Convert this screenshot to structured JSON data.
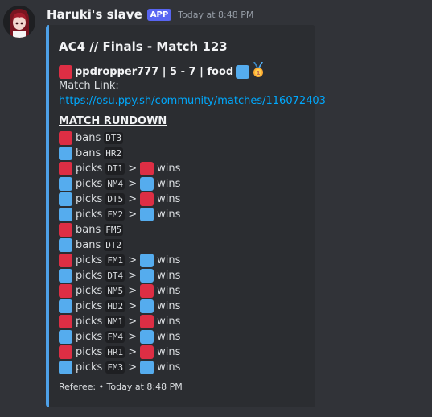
{
  "message": {
    "username": "Haruki's slave",
    "badge": "APP",
    "timestamp": "Today at 8:48 PM"
  },
  "embed": {
    "accent_color": "#4ea1e8",
    "title": "AC4 // Finals - Match 123",
    "score_line": "ppdropper777 | 5 - 7 | food",
    "left_team_color": "red",
    "right_team_color": "blue",
    "winner_icon": "1st-place-medal-icon",
    "match_link_label": "Match Link:",
    "match_link_url": "https://osu.ppy.sh/community/matches/116072403",
    "rundown_title": "MATCH RUNDOWN",
    "rows": [
      {
        "team": "red",
        "action": "bans",
        "map": "DT3"
      },
      {
        "team": "blue",
        "action": "bans",
        "map": "HR2"
      },
      {
        "team": "red",
        "action": "picks",
        "map": "DT1",
        "winner": "red",
        "result": "wins"
      },
      {
        "team": "blue",
        "action": "picks",
        "map": "NM4",
        "winner": "blue",
        "result": "wins"
      },
      {
        "team": "blue",
        "action": "picks",
        "map": "DT5",
        "winner": "red",
        "result": "wins"
      },
      {
        "team": "blue",
        "action": "picks",
        "map": "FM2",
        "winner": "blue",
        "result": "wins"
      },
      {
        "team": "red",
        "action": "bans",
        "map": "FM5"
      },
      {
        "team": "blue",
        "action": "bans",
        "map": "DT2"
      },
      {
        "team": "red",
        "action": "picks",
        "map": "FM1",
        "winner": "blue",
        "result": "wins"
      },
      {
        "team": "blue",
        "action": "picks",
        "map": "DT4",
        "winner": "blue",
        "result": "wins"
      },
      {
        "team": "red",
        "action": "picks",
        "map": "NM5",
        "winner": "red",
        "result": "wins"
      },
      {
        "team": "blue",
        "action": "picks",
        "map": "HD2",
        "winner": "blue",
        "result": "wins"
      },
      {
        "team": "red",
        "action": "picks",
        "map": "NM1",
        "winner": "red",
        "result": "wins"
      },
      {
        "team": "blue",
        "action": "picks",
        "map": "FM4",
        "winner": "blue",
        "result": "wins"
      },
      {
        "team": "red",
        "action": "picks",
        "map": "HR1",
        "winner": "red",
        "result": "wins"
      },
      {
        "team": "blue",
        "action": "picks",
        "map": "FM3",
        "winner": "blue",
        "result": "wins"
      }
    ],
    "arrow": ">",
    "footer": "Referee: • Today at 8:48 PM"
  }
}
